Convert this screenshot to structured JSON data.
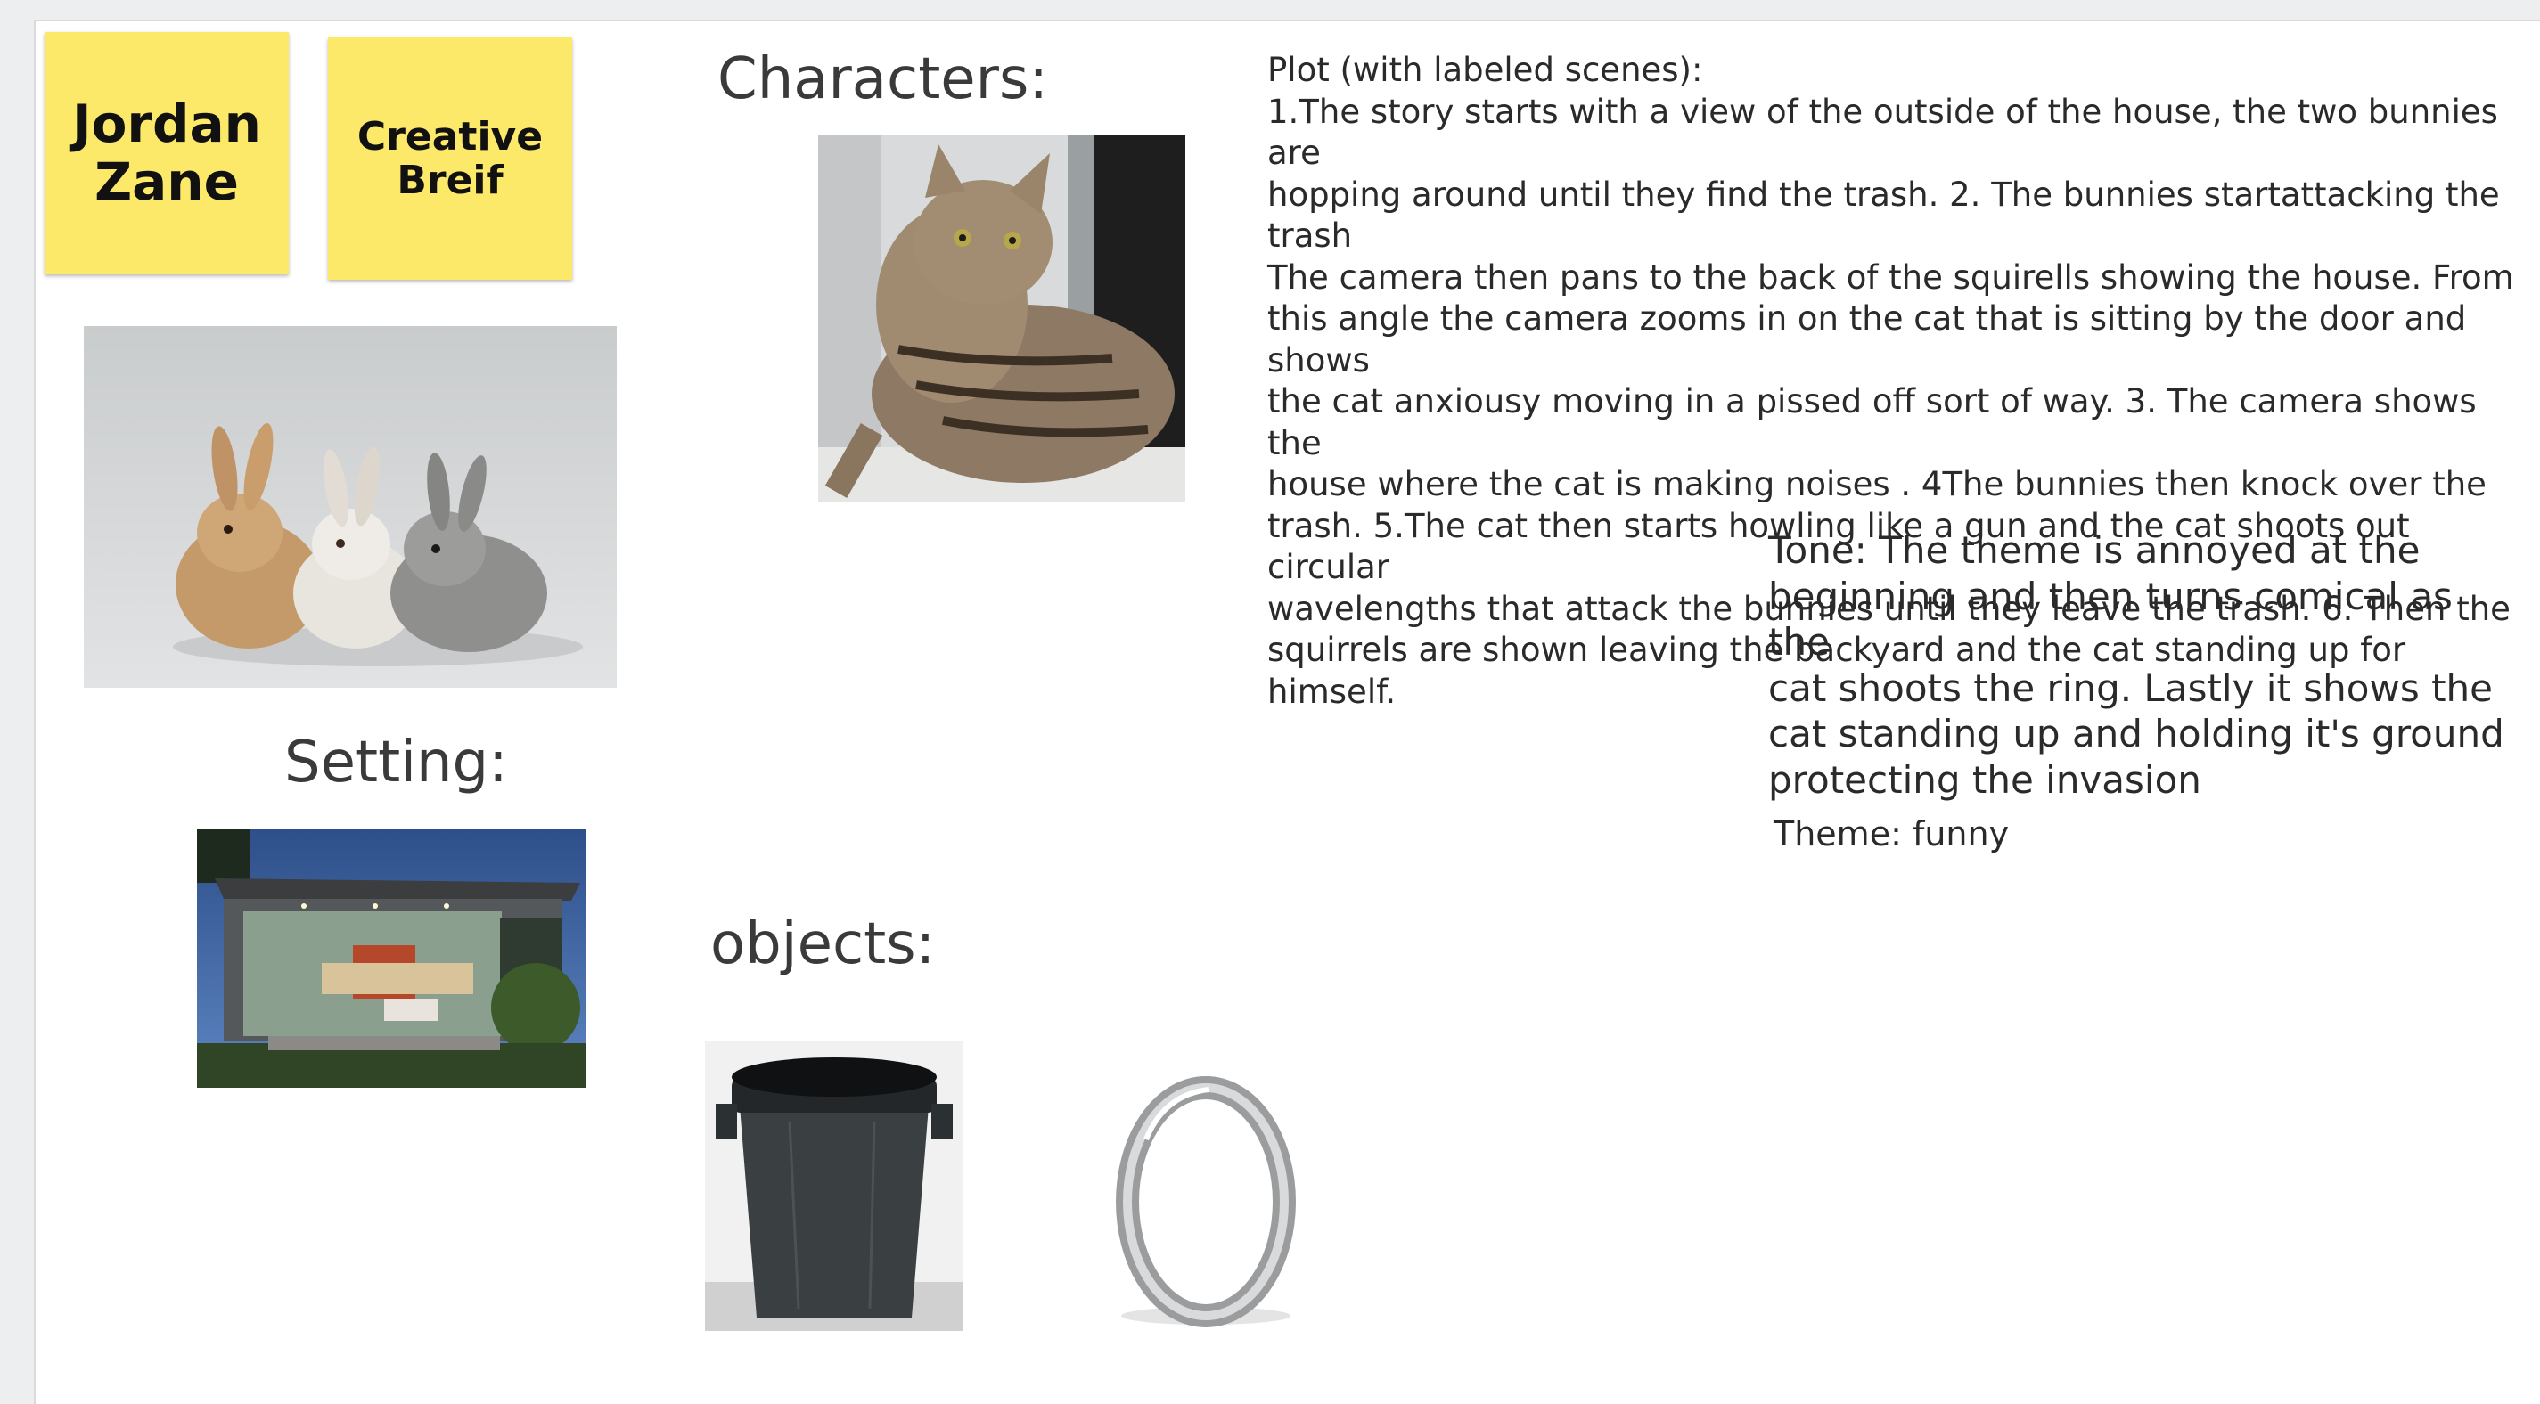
{
  "sticky_notes": [
    {
      "line1": "Jordan",
      "line2": "Zane",
      "color": "#fce96a"
    },
    {
      "line1": "Creative",
      "line2": "Breif",
      "color": "#fce96a"
    }
  ],
  "headings": {
    "characters": "Characters:",
    "setting": "Setting:",
    "objects": "objects:"
  },
  "plot": {
    "title": "Plot (with labeled scenes):",
    "lines": [
      "1.The story starts with a view of the outside of the house, the two bunnies are",
      "hopping around until they find the trash. 2. The bunnies startattacking the trash",
      "The camera then pans to the back of the squirells showing the house. From",
      "this angle the camera zooms in on the cat that is sitting by  the door and shows",
      "the cat anxiousy moving in a pissed off sort of way. 3. The camera shows the",
      "house where the cat is making noises . 4The bunnies then knock over the",
      "trash. 5.The cat then starts howling like a gun and the cat shoots out circular",
      "wavelengths that attack the bunnies until they leave the trash. 6. Then the",
      "squirrels are shown leaving the backyard and the cat standing up for himself."
    ]
  },
  "tone": {
    "lines": [
      "Tone: The theme is annoyed at the",
      "beginning and then turns comical as the",
      "cat shoots the ring. Lastly it shows the",
      "cat standing up and holding it's ground",
      "protecting the invasion"
    ]
  },
  "theme": "Theme: funny",
  "images": {
    "bunnies": "bunnies-photo",
    "cat": "tabby-cat-photo",
    "house": "modern-house-photo",
    "trash_can": "trash-can-photo",
    "ring": "silver-ring-photo"
  }
}
